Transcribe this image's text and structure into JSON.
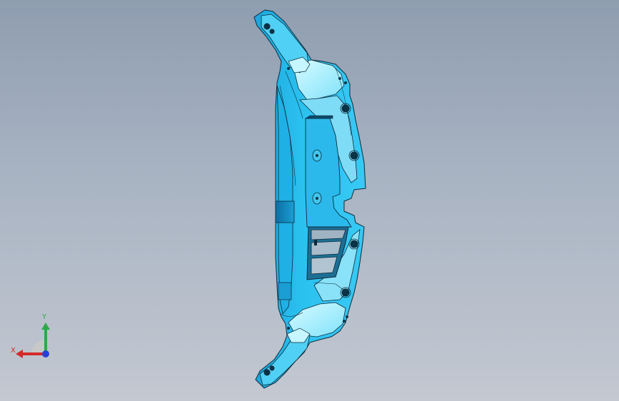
{
  "viewport": {
    "background_top": "#8f9db0",
    "background_bottom": "#c3c8d1"
  },
  "model": {
    "body_color": "#22b8ec",
    "highlight_color": "#a8f0ff",
    "edge_color": "#0d2a3a"
  },
  "triad": {
    "x_label": "X",
    "y_label": "Y",
    "x_color": "#d42a2a",
    "y_color": "#2fa84a",
    "z_color": "#2a3fd4"
  }
}
